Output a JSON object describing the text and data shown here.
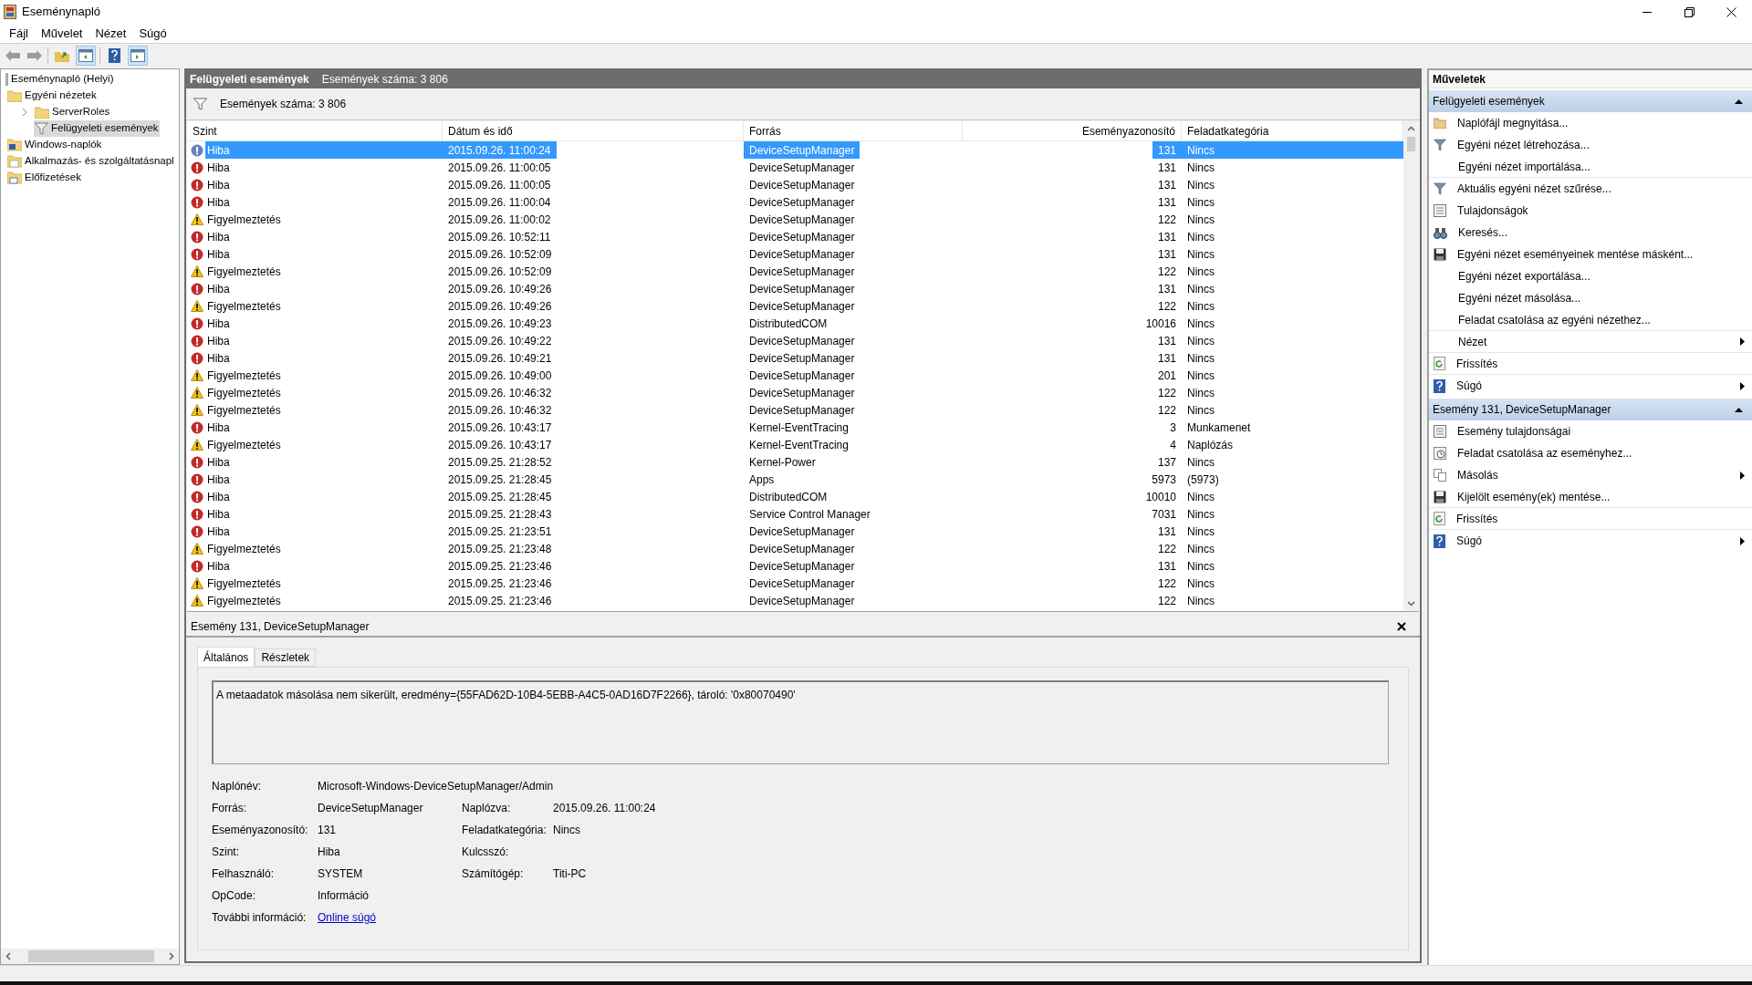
{
  "window": {
    "title": "Eseménynapló"
  },
  "menu": [
    "Fájl",
    "Művelet",
    "Nézet",
    "Súgó"
  ],
  "tree": [
    {
      "label": "Eseménynapló (Helyi)",
      "kind": "root",
      "selected": false,
      "children": [
        {
          "label": "Egyéni nézetek",
          "kind": "folder",
          "selected": false,
          "children": [
            {
              "label": "ServerRoles",
              "kind": "folder",
              "selected": false,
              "expanded": false
            },
            {
              "label": "Felügyeleti események",
              "kind": "filter",
              "selected": true
            }
          ]
        },
        {
          "label": "Windows-naplók",
          "kind": "logs",
          "selected": false
        },
        {
          "label": "Alkalmazás- és szolgáltatásnapl",
          "kind": "apps",
          "selected": false
        },
        {
          "label": "Előfizetések",
          "kind": "subs",
          "selected": false
        }
      ]
    }
  ],
  "content": {
    "title": "Felügyeleti események",
    "count": "Események száma: 3 806",
    "filter_count": "Események száma: 3 806"
  },
  "table": {
    "columns": [
      "Szint",
      "Dátum és idő",
      "Forrás",
      "Eseményazonosító",
      "Feladatkategória"
    ],
    "rows": [
      {
        "kind": "error",
        "selected": true,
        "cells": [
          "Hiba",
          "2015.09.26. 11:00:24",
          "DeviceSetupManager",
          "131",
          "Nincs"
        ]
      },
      {
        "kind": "error",
        "selected": false,
        "cells": [
          "Hiba",
          "2015.09.26. 11:00:05",
          "DeviceSetupManager",
          "131",
          "Nincs"
        ]
      },
      {
        "kind": "error",
        "selected": false,
        "cells": [
          "Hiba",
          "2015.09.26. 11:00:05",
          "DeviceSetupManager",
          "131",
          "Nincs"
        ]
      },
      {
        "kind": "error",
        "selected": false,
        "cells": [
          "Hiba",
          "2015.09.26. 11:00:04",
          "DeviceSetupManager",
          "131",
          "Nincs"
        ]
      },
      {
        "kind": "warning",
        "selected": false,
        "cells": [
          "Figyelmeztetés",
          "2015.09.26. 11:00:02",
          "DeviceSetupManager",
          "122",
          "Nincs"
        ]
      },
      {
        "kind": "error",
        "selected": false,
        "cells": [
          "Hiba",
          "2015.09.26. 10:52:11",
          "DeviceSetupManager",
          "131",
          "Nincs"
        ]
      },
      {
        "kind": "error",
        "selected": false,
        "cells": [
          "Hiba",
          "2015.09.26. 10:52:09",
          "DeviceSetupManager",
          "131",
          "Nincs"
        ]
      },
      {
        "kind": "warning",
        "selected": false,
        "cells": [
          "Figyelmeztetés",
          "2015.09.26. 10:52:09",
          "DeviceSetupManager",
          "122",
          "Nincs"
        ]
      },
      {
        "kind": "error",
        "selected": false,
        "cells": [
          "Hiba",
          "2015.09.26. 10:49:26",
          "DeviceSetupManager",
          "131",
          "Nincs"
        ]
      },
      {
        "kind": "warning",
        "selected": false,
        "cells": [
          "Figyelmeztetés",
          "2015.09.26. 10:49:26",
          "DeviceSetupManager",
          "122",
          "Nincs"
        ]
      },
      {
        "kind": "error",
        "selected": false,
        "cells": [
          "Hiba",
          "2015.09.26. 10:49:23",
          "DistributedCOM",
          "10016",
          "Nincs"
        ]
      },
      {
        "kind": "error",
        "selected": false,
        "cells": [
          "Hiba",
          "2015.09.26. 10:49:22",
          "DeviceSetupManager",
          "131",
          "Nincs"
        ]
      },
      {
        "kind": "error",
        "selected": false,
        "cells": [
          "Hiba",
          "2015.09.26. 10:49:21",
          "DeviceSetupManager",
          "131",
          "Nincs"
        ]
      },
      {
        "kind": "warning",
        "selected": false,
        "cells": [
          "Figyelmeztetés",
          "2015.09.26. 10:49:00",
          "DeviceSetupManager",
          "201",
          "Nincs"
        ]
      },
      {
        "kind": "warning",
        "selected": false,
        "cells": [
          "Figyelmeztetés",
          "2015.09.26. 10:46:32",
          "DeviceSetupManager",
          "122",
          "Nincs"
        ]
      },
      {
        "kind": "warning",
        "selected": false,
        "cells": [
          "Figyelmeztetés",
          "2015.09.26. 10:46:32",
          "DeviceSetupManager",
          "122",
          "Nincs"
        ]
      },
      {
        "kind": "error",
        "selected": false,
        "cells": [
          "Hiba",
          "2015.09.26. 10:43:17",
          "Kernel-EventTracing",
          "3",
          "Munkamenet"
        ]
      },
      {
        "kind": "warning",
        "selected": false,
        "cells": [
          "Figyelmeztetés",
          "2015.09.26. 10:43:17",
          "Kernel-EventTracing",
          "4",
          "Naplózás"
        ]
      },
      {
        "kind": "error",
        "selected": false,
        "cells": [
          "Hiba",
          "2015.09.25. 21:28:52",
          "Kernel-Power",
          "137",
          "Nincs"
        ]
      },
      {
        "kind": "error",
        "selected": false,
        "cells": [
          "Hiba",
          "2015.09.25. 21:28:45",
          "Apps",
          "5973",
          "(5973)"
        ]
      },
      {
        "kind": "error",
        "selected": false,
        "cells": [
          "Hiba",
          "2015.09.25. 21:28:45",
          "DistributedCOM",
          "10010",
          "Nincs"
        ]
      },
      {
        "kind": "error",
        "selected": false,
        "cells": [
          "Hiba",
          "2015.09.25. 21:28:43",
          "Service Control Manager",
          "7031",
          "Nincs"
        ]
      },
      {
        "kind": "error",
        "selected": false,
        "cells": [
          "Hiba",
          "2015.09.25. 21:23:51",
          "DeviceSetupManager",
          "131",
          "Nincs"
        ]
      },
      {
        "kind": "warning",
        "selected": false,
        "cells": [
          "Figyelmeztetés",
          "2015.09.25. 21:23:48",
          "DeviceSetupManager",
          "122",
          "Nincs"
        ]
      },
      {
        "kind": "error",
        "selected": false,
        "cells": [
          "Hiba",
          "2015.09.25. 21:23:46",
          "DeviceSetupManager",
          "131",
          "Nincs"
        ]
      },
      {
        "kind": "warning",
        "selected": false,
        "cells": [
          "Figyelmeztetés",
          "2015.09.25. 21:23:46",
          "DeviceSetupManager",
          "122",
          "Nincs"
        ]
      },
      {
        "kind": "warning",
        "selected": false,
        "cells": [
          "Figyelmeztetés",
          "2015.09.25. 21:23:46",
          "DeviceSetupManager",
          "122",
          "Nincs"
        ]
      }
    ]
  },
  "details": {
    "title": "Esemény 131, DeviceSetupManager",
    "tabs": [
      {
        "label": "Általános",
        "selected": true
      },
      {
        "label": "Részletek",
        "selected": false
      }
    ],
    "message": "A metaadatok másolása nem sikerült, eredmény={55FAD62D-10B4-5EBB-A4C5-0AD16D7F2266}, tároló: '0x80070490'",
    "fields": [
      [
        {
          "label": "Naplónév:",
          "value": "Microsoft-Windows-DeviceSetupManager/Admin"
        }
      ],
      [
        {
          "label": "Forrás:",
          "value": "DeviceSetupManager"
        },
        {
          "label": "Naplózva:",
          "value": "2015.09.26. 11:00:24"
        }
      ],
      [
        {
          "label": "Eseményazonosító:",
          "value": "131"
        },
        {
          "label": "Feladatkategória:",
          "value": "Nincs"
        }
      ],
      [
        {
          "label": "Szint:",
          "value": "Hiba"
        },
        {
          "label": "Kulcsszó:"
        }
      ],
      [
        {
          "label": "Felhasználó:",
          "value": "SYSTEM"
        },
        {
          "label": "Számítógép:",
          "value": "Titi-PC"
        }
      ],
      [
        {
          "label": "OpCode:",
          "value": "Információ"
        }
      ],
      [
        {
          "label": "További információ:",
          "link": "Online súgó"
        }
      ]
    ]
  },
  "actions": {
    "title": "Műveletek",
    "sections": [
      {
        "title": "Felügyeleti események",
        "expanded": true,
        "items": [
          {
            "label": "Naplófájl megnyitása...",
            "kind": "open",
            "submenu": false,
            "divider_after": false
          },
          {
            "label": "Egyéni nézet létrehozása...",
            "kind": "filter",
            "submenu": false,
            "divider_after": false
          },
          {
            "label": "Egyéni nézet importálása...",
            "kind": "none",
            "submenu": false,
            "divider_after": true
          },
          {
            "label": "Aktuális egyéni nézet szűrése...",
            "kind": "filter",
            "submenu": false,
            "divider_after": false
          },
          {
            "label": "Tulajdonságok",
            "kind": "props",
            "submenu": false,
            "divider_after": false
          },
          {
            "label": "Keresés...",
            "kind": "find",
            "submenu": false,
            "divider_after": false
          },
          {
            "label": "Egyéni nézet eseményeinek mentése másként...",
            "kind": "save",
            "submenu": false,
            "divider_after": false
          },
          {
            "label": "Egyéni nézet exportálása...",
            "kind": "none",
            "submenu": false,
            "divider_after": false
          },
          {
            "label": "Egyéni nézet másolása...",
            "kind": "none",
            "submenu": false,
            "divider_after": false
          },
          {
            "label": "Feladat csatolása az egyéni nézethez...",
            "kind": "none",
            "submenu": false,
            "divider_after": true
          },
          {
            "label": "Nézet",
            "kind": "none",
            "submenu": true,
            "divider_after": true
          },
          {
            "label": "Frissítés",
            "kind": "refresh",
            "submenu": false,
            "divider_after": true
          },
          {
            "label": "Súgó",
            "kind": "help",
            "submenu": true,
            "divider_after": false
          }
        ]
      },
      {
        "title": "Esemény 131, DeviceSetupManager",
        "expanded": true,
        "items": [
          {
            "label": "Esemény tulajdonságai",
            "kind": "props",
            "submenu": false,
            "divider_after": false
          },
          {
            "label": "Feladat csatolása az eseményhez...",
            "kind": "task",
            "submenu": false,
            "divider_after": false
          },
          {
            "label": "Másolás",
            "kind": "copy",
            "submenu": true,
            "divider_after": false
          },
          {
            "label": "Kijelölt esemény(ek) mentése...",
            "kind": "save",
            "submenu": false,
            "divider_after": true
          },
          {
            "label": "Frissítés",
            "kind": "refresh",
            "submenu": false,
            "divider_after": true
          },
          {
            "label": "Súgó",
            "kind": "help",
            "submenu": true,
            "divider_after": false
          }
        ]
      }
    ]
  }
}
